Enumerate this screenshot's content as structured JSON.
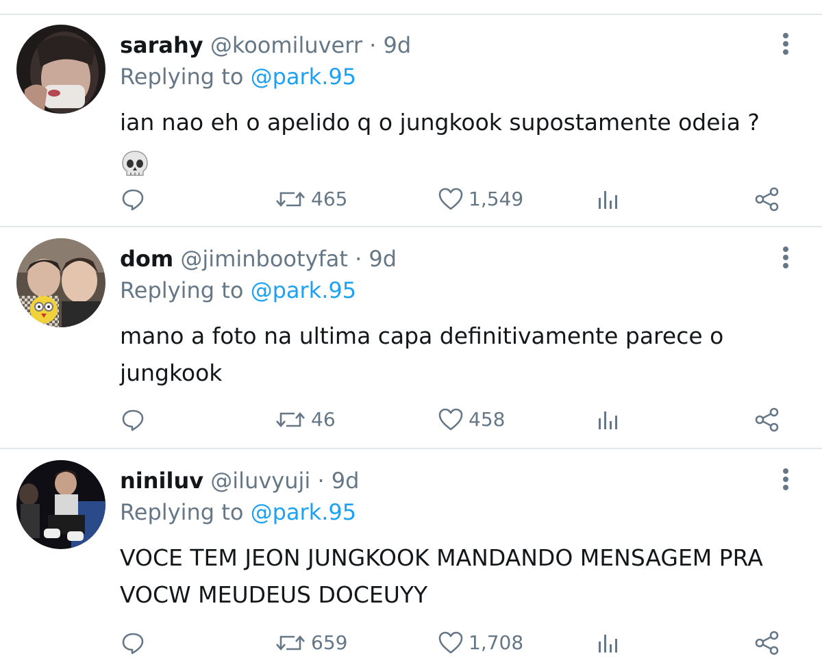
{
  "tweets": [
    {
      "name": "sarahy",
      "handle": "@koomiluverr",
      "separator": "·",
      "time": "9d",
      "replying_prefix": "Replying to",
      "replying_to": "@park.95",
      "text": "ian nao eh o apelido q o jungkook supostamente odeia ?",
      "emoji": "skull",
      "retweets": "465",
      "likes": "1,549"
    },
    {
      "name": "dom",
      "handle": "@jiminbootyfat",
      "separator": "·",
      "time": "9d",
      "replying_prefix": "Replying to",
      "replying_to": "@park.95",
      "text": "mano a foto na ultima capa definitivamente parece o jungkook",
      "retweets": "46",
      "likes": "458"
    },
    {
      "name": "niniluv",
      "handle": "@iluvyuji",
      "separator": "·",
      "time": "9d",
      "replying_prefix": "Replying to",
      "replying_to": "@park.95",
      "text": "VOCE TEM JEON JUNGKOOK MANDANDO MENSAGEM PRA VOCW MEUDEUS DOCEUYY",
      "retweets": "659",
      "likes": "1,708"
    }
  ],
  "icons": {
    "reply": "reply-icon",
    "retweet": "retweet-icon",
    "like": "heart-icon",
    "analytics": "analytics-icon",
    "share": "share-icon",
    "more": "more-vertical-icon"
  },
  "colors": {
    "text": "#14171a",
    "secondary": "#657786",
    "link": "#1da1f2",
    "divider": "#e1e8ed"
  }
}
